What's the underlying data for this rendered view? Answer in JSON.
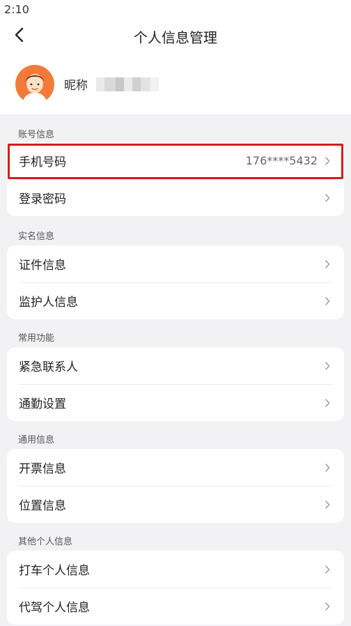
{
  "status": {
    "time": "2:10"
  },
  "header": {
    "title": "个人信息管理"
  },
  "profile": {
    "nickname_label": "昵称",
    "nickname_value": ""
  },
  "sections": {
    "account": {
      "title": "账号信息",
      "items": [
        {
          "label": "手机号码",
          "value": "176****5432"
        },
        {
          "label": "登录密码"
        }
      ]
    },
    "realname": {
      "title": "实名信息",
      "items": [
        {
          "label": "证件信息"
        },
        {
          "label": "监护人信息"
        }
      ]
    },
    "common": {
      "title": "常用功能",
      "items": [
        {
          "label": "紧急联系人"
        },
        {
          "label": "通勤设置"
        }
      ]
    },
    "general": {
      "title": "通用信息",
      "items": [
        {
          "label": "开票信息"
        },
        {
          "label": "位置信息"
        }
      ]
    },
    "other": {
      "title": "其他个人信息",
      "items": [
        {
          "label": "打车个人信息"
        },
        {
          "label": "代驾个人信息"
        }
      ]
    }
  },
  "icons": {
    "back": "chevron-left-icon",
    "row_arrow": "chevron-right-icon",
    "avatar": "user-avatar"
  },
  "colors": {
    "background": "#f2f2f4",
    "avatar_orange": "#f47a3a",
    "highlight_red": "#d41c1c"
  }
}
